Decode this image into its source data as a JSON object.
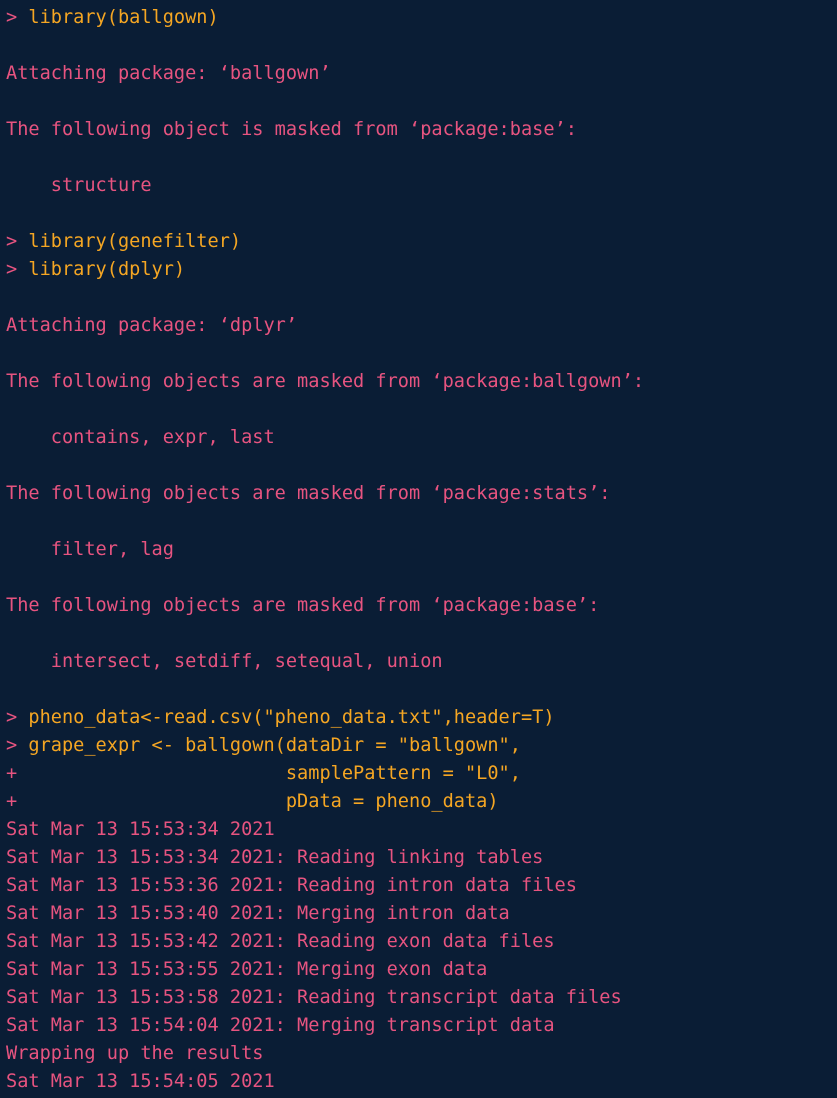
{
  "lines": [
    {
      "type": "input",
      "prompt": "> ",
      "text": "library(ballgown)"
    },
    {
      "type": "blank"
    },
    {
      "type": "msg",
      "text": "Attaching package: ‘ballgown’"
    },
    {
      "type": "blank"
    },
    {
      "type": "msg",
      "text": "The following object is masked from ‘package:base’:"
    },
    {
      "type": "blank"
    },
    {
      "type": "msg",
      "text": "    structure"
    },
    {
      "type": "blank"
    },
    {
      "type": "input",
      "prompt": "> ",
      "text": "library(genefilter)"
    },
    {
      "type": "input",
      "prompt": "> ",
      "text": "library(dplyr)"
    },
    {
      "type": "blank"
    },
    {
      "type": "msg",
      "text": "Attaching package: ‘dplyr’"
    },
    {
      "type": "blank"
    },
    {
      "type": "msg",
      "text": "The following objects are masked from ‘package:ballgown’:"
    },
    {
      "type": "blank"
    },
    {
      "type": "msg",
      "text": "    contains, expr, last"
    },
    {
      "type": "blank"
    },
    {
      "type": "msg",
      "text": "The following objects are masked from ‘package:stats’:"
    },
    {
      "type": "blank"
    },
    {
      "type": "msg",
      "text": "    filter, lag"
    },
    {
      "type": "blank"
    },
    {
      "type": "msg",
      "text": "The following objects are masked from ‘package:base’:"
    },
    {
      "type": "blank"
    },
    {
      "type": "msg",
      "text": "    intersect, setdiff, setequal, union"
    },
    {
      "type": "blank"
    },
    {
      "type": "input",
      "prompt": "> ",
      "text": "pheno_data<-read.csv(\"pheno_data.txt\",header=T)"
    },
    {
      "type": "input",
      "prompt": "> ",
      "text": "grape_expr <- ballgown(dataDir = \"ballgown\","
    },
    {
      "type": "input",
      "prompt": "+ ",
      "text": "                       samplePattern = \"L0\","
    },
    {
      "type": "input",
      "prompt": "+ ",
      "text": "                       pData = pheno_data)"
    },
    {
      "type": "log",
      "text": "Sat Mar 13 15:53:34 2021"
    },
    {
      "type": "log",
      "text": "Sat Mar 13 15:53:34 2021: Reading linking tables"
    },
    {
      "type": "log",
      "text": "Sat Mar 13 15:53:36 2021: Reading intron data files"
    },
    {
      "type": "log",
      "text": "Sat Mar 13 15:53:40 2021: Merging intron data"
    },
    {
      "type": "log",
      "text": "Sat Mar 13 15:53:42 2021: Reading exon data files"
    },
    {
      "type": "log",
      "text": "Sat Mar 13 15:53:55 2021: Merging exon data"
    },
    {
      "type": "log",
      "text": "Sat Mar 13 15:53:58 2021: Reading transcript data files"
    },
    {
      "type": "log",
      "text": "Sat Mar 13 15:54:04 2021: Merging transcript data"
    },
    {
      "type": "log",
      "text": "Wrapping up the results"
    },
    {
      "type": "log",
      "text": "Sat Mar 13 15:54:05 2021"
    }
  ]
}
